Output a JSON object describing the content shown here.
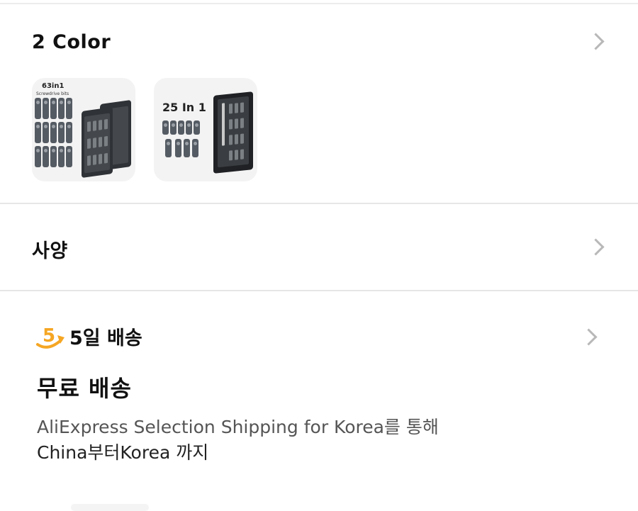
{
  "color_section": {
    "title": "2 Color",
    "thumbnails": [
      {
        "label": "63in1",
        "sublabel": "Screwdrive bits"
      },
      {
        "label": "25 In 1"
      }
    ]
  },
  "spec_section": {
    "title": "사양"
  },
  "shipping_section": {
    "badge_number": "5",
    "title": "5일 배송",
    "free_shipping": "무료 배송",
    "description_line1": "AliExpress Selection Shipping for Korea를 통해",
    "description_line2": "China부터Korea 까지"
  },
  "colors": {
    "accent": "#f5a623",
    "chevron": "#b8b8b8",
    "divider": "#e6e6e6",
    "muted_text": "#555555"
  }
}
